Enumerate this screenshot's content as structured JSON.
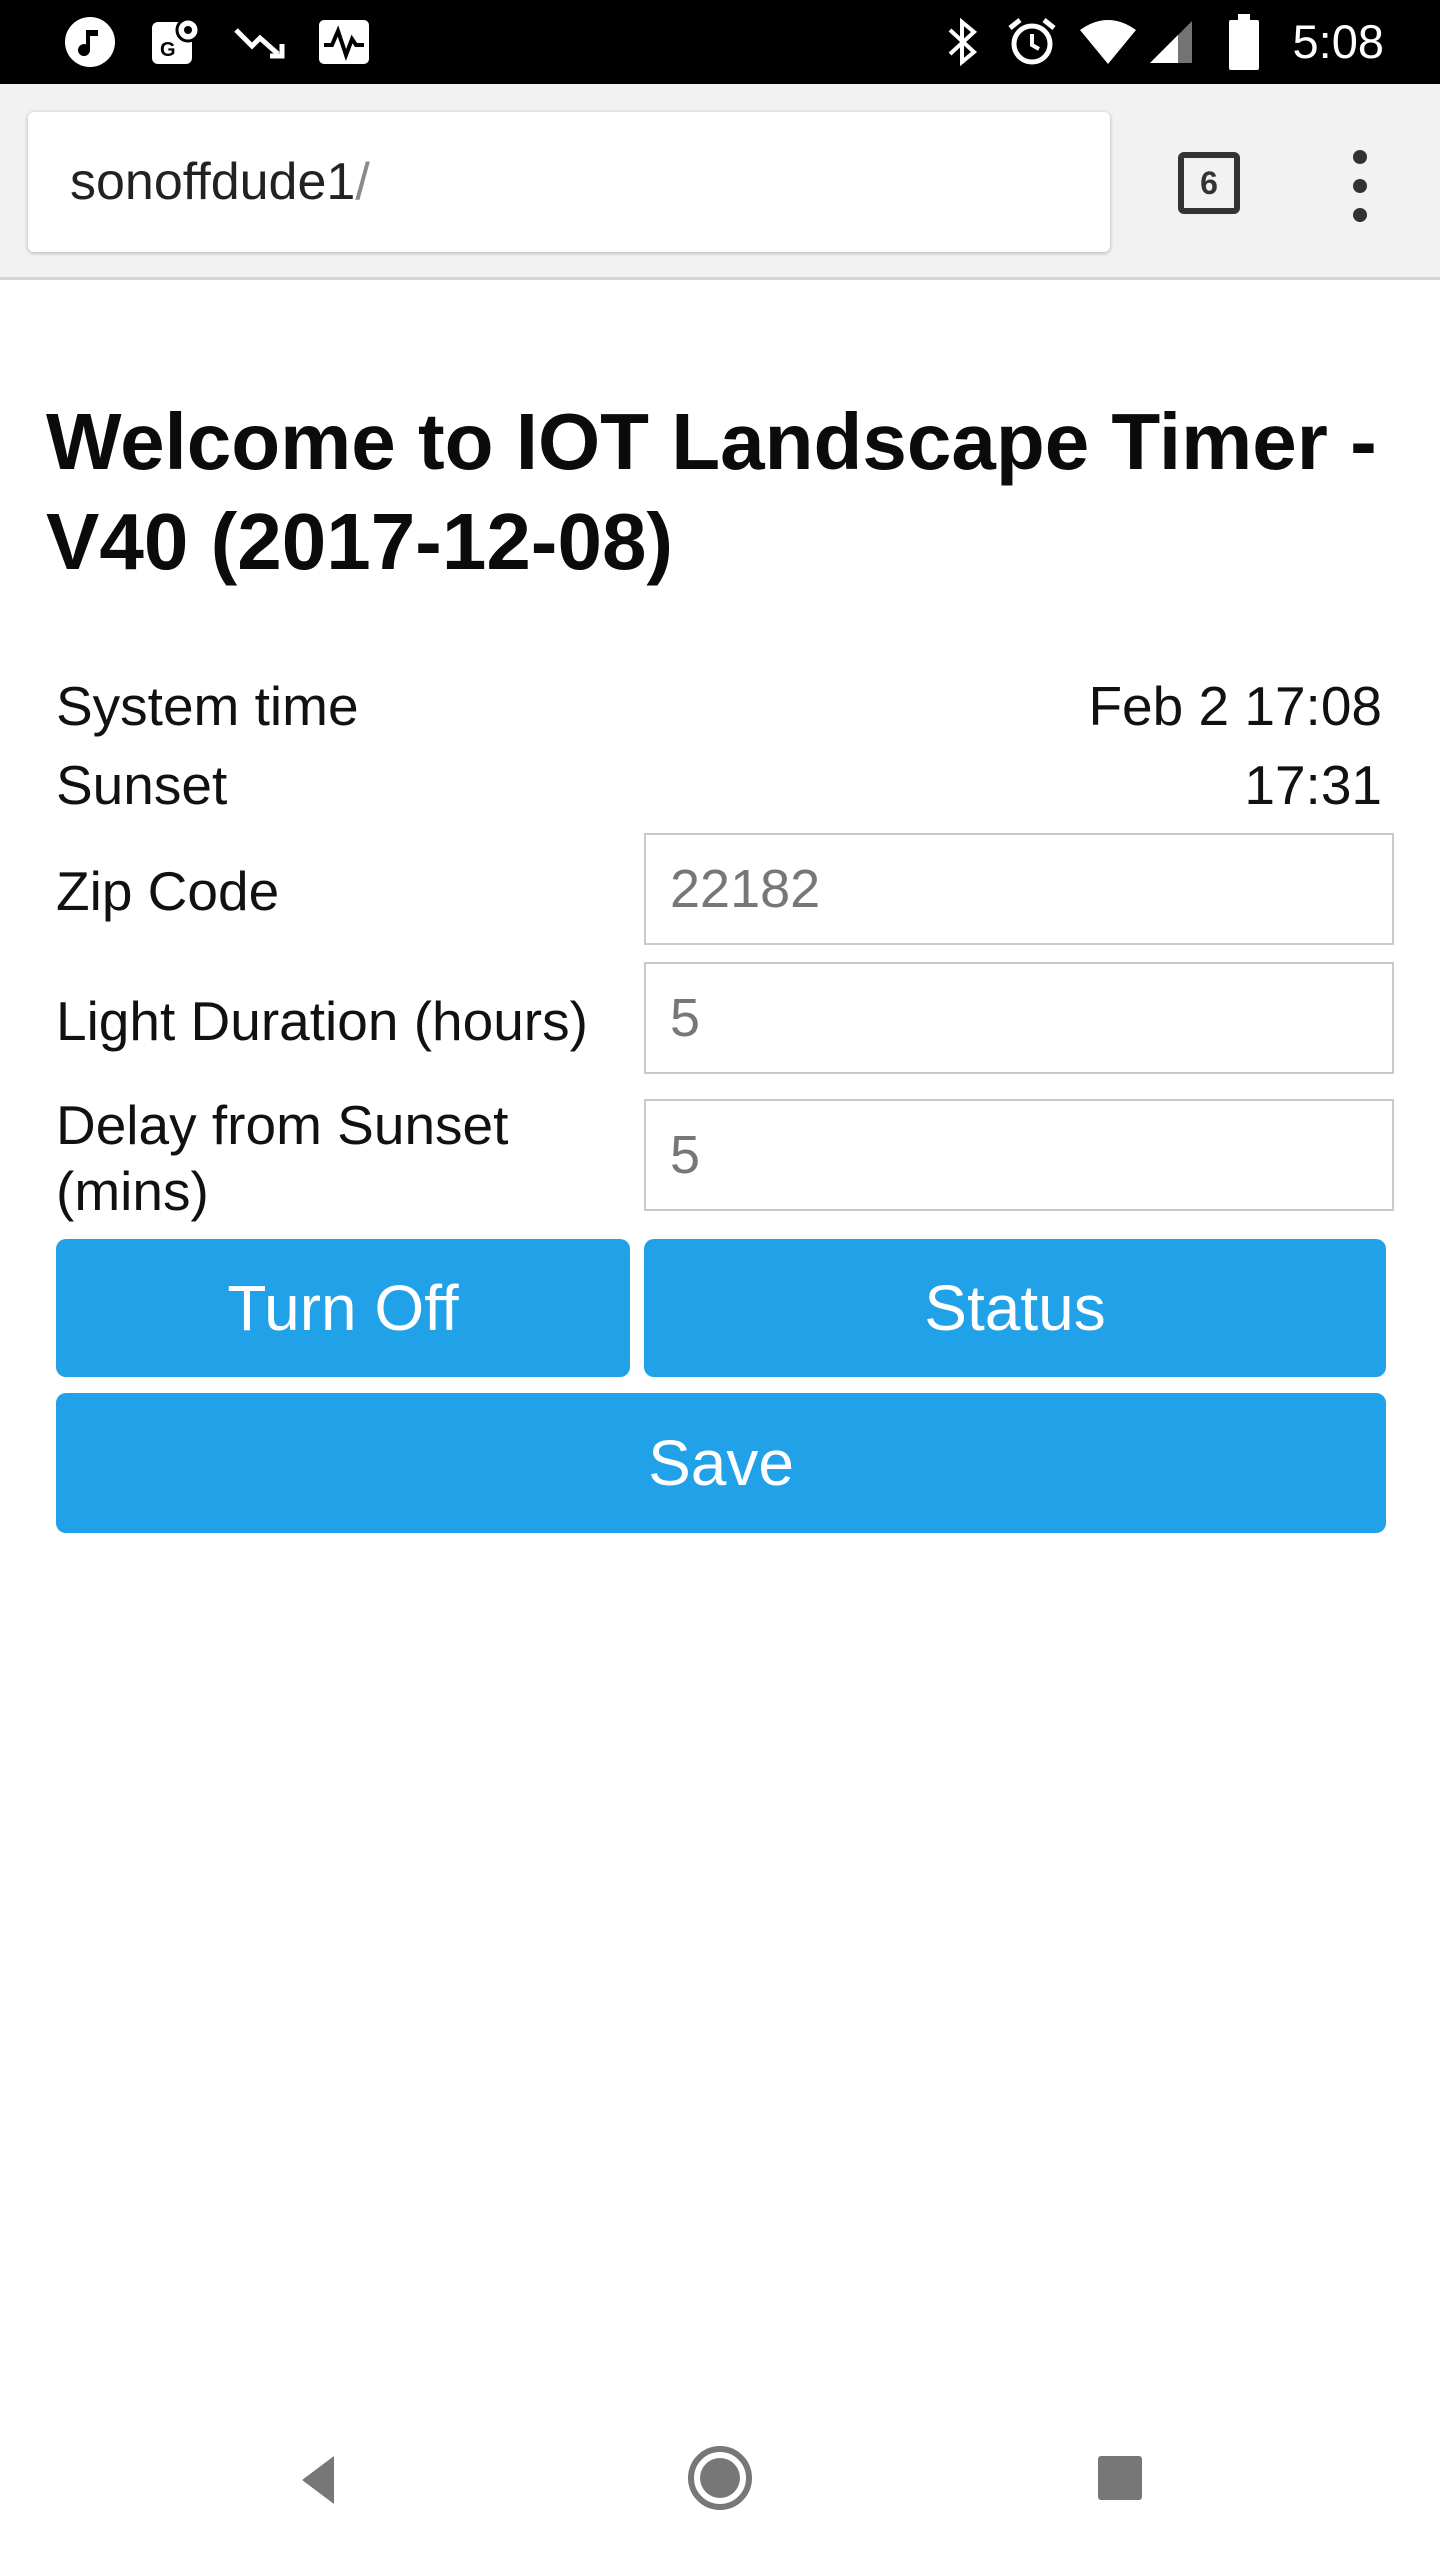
{
  "status_bar": {
    "time": "5:08",
    "icons": [
      "music-note-icon",
      "maps-icon",
      "trending-down-icon",
      "activity-icon",
      "bluetooth-icon",
      "alarm-icon",
      "wifi-icon",
      "cell-signal-icon",
      "battery-icon"
    ]
  },
  "browser": {
    "url_host": "sonoffdude1",
    "url_path": "/",
    "tab_count": "6",
    "icons": [
      "tab-switcher-icon",
      "overflow-menu-icon"
    ]
  },
  "page": {
    "title": "Welcome to IOT Landscape Timer - V40 (2017-12-08)",
    "system_time_label": "System time",
    "system_time_value": "Feb 2 17:08",
    "sunset_label": "Sunset",
    "sunset_value": "17:31",
    "zip_code_label": "Zip Code",
    "zip_code_value": "22182",
    "light_duration_label": "Light Duration (hours)",
    "light_duration_value": "5",
    "delay_label": "Delay from Sunset (mins)",
    "delay_value": "5",
    "turn_off_label": "Turn Off",
    "status_label": "Status",
    "save_label": "Save",
    "accent_color": "#21a1e8"
  },
  "nav_bar": {
    "icons": [
      "back-icon",
      "home-icon",
      "recents-icon"
    ]
  }
}
